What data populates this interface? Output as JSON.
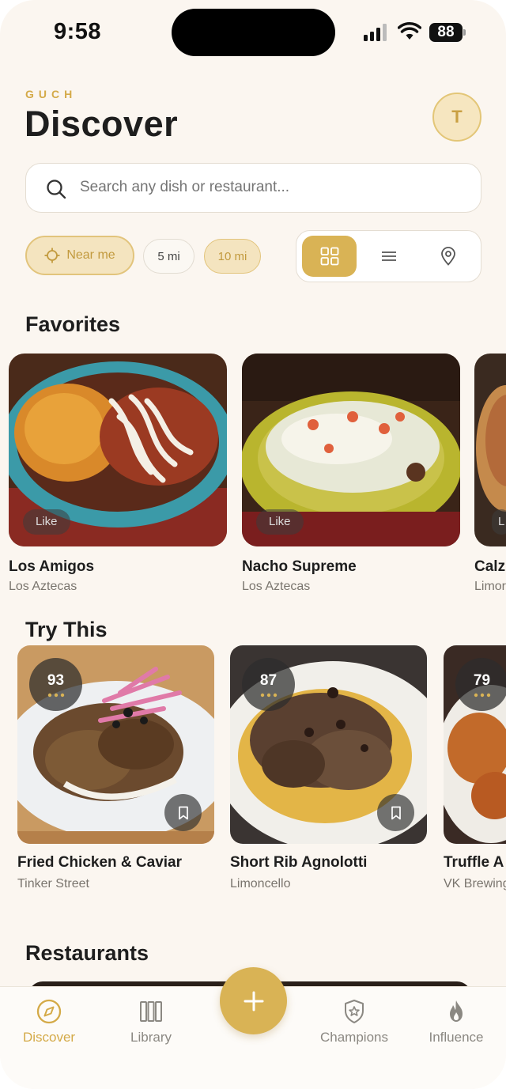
{
  "status_bar": {
    "time": "9:58",
    "battery": "88"
  },
  "header": {
    "brand": "GUCH",
    "title": "Discover",
    "avatar_initial": "T"
  },
  "search": {
    "placeholder": "Search any dish or restaurant..."
  },
  "filters": {
    "near_me": "Near me",
    "five_mi": "5 mi",
    "ten_mi": "10 mi"
  },
  "view_modes": [
    {
      "icon": "grid-icon",
      "active": true
    },
    {
      "icon": "list-icon",
      "active": false
    },
    {
      "icon": "map-pin-icon",
      "active": false
    }
  ],
  "favorites": {
    "title": "Favorites",
    "items": [
      {
        "name": "Los Amigos",
        "restaurant": "Los Aztecas",
        "badge": "Like"
      },
      {
        "name": "Nacho Supreme",
        "restaurant": "Los Aztecas",
        "badge": "Like"
      },
      {
        "name": "Calz",
        "restaurant": "Limor",
        "badge": "L"
      }
    ]
  },
  "try_this": {
    "title": "Try This",
    "items": [
      {
        "name": "Fried Chicken & Caviar",
        "restaurant": "Tinker Street",
        "score": "93"
      },
      {
        "name": "Short Rib Agnolotti",
        "restaurant": "Limoncello",
        "score": "87"
      },
      {
        "name": "Truffle A",
        "restaurant": "VK Brewing",
        "score": "79"
      }
    ]
  },
  "restaurants": {
    "title": "Restaurants"
  },
  "tabbar": {
    "discover": "Discover",
    "library": "Library",
    "champions": "Champions",
    "influence": "Influence"
  },
  "colors": {
    "accent": "#d9b355",
    "accent_text": "#d4aa48",
    "background": "#fbf6f0"
  }
}
